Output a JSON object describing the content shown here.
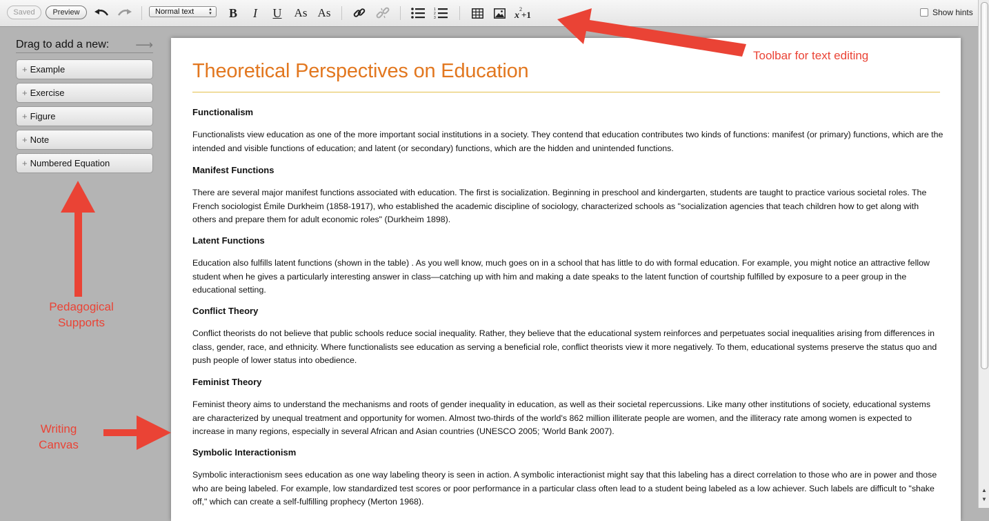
{
  "toolbar": {
    "saved_label": "Saved",
    "preview_label": "Preview",
    "style_select_value": "Normal text",
    "bold_glyph": "B",
    "italic_glyph": "I",
    "underline_glyph": "U",
    "superscript_glyph": "As",
    "subscript_glyph": "As",
    "show_hints_label": "Show hints",
    "show_hints_checked": false,
    "icons": [
      "undo-icon",
      "redo-icon",
      "link-icon",
      "unlink-icon",
      "bullet-list-icon",
      "numbered-list-icon",
      "table-icon",
      "image-icon",
      "math-icon"
    ]
  },
  "sidebar": {
    "heading": "Drag to add a new:",
    "items": [
      {
        "label": "Example"
      },
      {
        "label": "Exercise"
      },
      {
        "label": "Figure"
      },
      {
        "label": "Note"
      },
      {
        "label": "Numbered Equation"
      }
    ]
  },
  "document": {
    "title": "Theoretical Perspectives on Education",
    "sections": [
      {
        "heading": "Functionalism",
        "body": "Functionalists view education as one of the more important social institutions in a society. They contend that education contributes two kinds of functions: manifest (or primary) functions, which are the intended and visible functions of education; and latent (or secondary) functions, which are the hidden and unintended functions."
      },
      {
        "heading": "Manifest Functions",
        "body": "There are several major manifest functions associated with education. The first is socialization. Beginning in preschool and kindergarten, students are taught to practice various societal roles. The French sociologist Émile Durkheim (1858-1917), who established the academic discipline of sociology, characterized schools as \"socialization agencies that teach children how to get along with others and prepare them for adult economic roles\" (Durkheim 1898)."
      },
      {
        "heading": "Latent Functions",
        "body": "Education also fulfills latent functions (shown in the table) . As you well know, much goes on in a school that has little to do with formal education. For example, you might notice an attractive fellow student when he gives a particularly interesting answer in class—catching up with him and making a date speaks to the latent function of courtship fulfilled by exposure to a peer group in the educational setting."
      },
      {
        "heading": "Conflict Theory",
        "body": "Conflict theorists do not believe that public schools reduce social inequality. Rather, they believe that the educational system reinforces and perpetuates social inequalities arising from differences in class, gender, race, and ethnicity. Where functionalists see education as serving a beneficial role, conflict theorists view it more negatively. To them, educational systems preserve the status quo and push people of lower status into obedience."
      },
      {
        "heading": "Feminist Theory",
        "body": "Feminist theory aims to understand the mechanisms and roots of gender inequality in education, as well as their societal repercussions. Like many other institutions of society, educational systems are characterized by unequal treatment and opportunity for women. Almost two-thirds of the world's 862 million illiterate people are women, and the illiteracy rate among women is expected to increase in many regions, especially in several African and Asian countries (UNESCO 2005; 'World Bank 2007)."
      },
      {
        "heading": "Symbolic Interactionism",
        "body": "Symbolic interactionism sees education as one way labeling theory is seen in action. A symbolic interactionist might say that this labeling has a direct correlation to those who are in power and those who are being labeled. For example, low standardized test scores or poor performance in a particular class often lead to a student being labeled as a low achiever. Such labels are difficult to \"shake off,\" which can create a self-fulfilling prophecy (Merton 1968)."
      }
    ]
  },
  "annotations": {
    "toolbar_note": "Toolbar for text editing",
    "pedagogical_note_line1": "Pedagogical",
    "pedagogical_note_line2": "Supports",
    "canvas_note_line1": "Writing",
    "canvas_note_line2": "Canvas",
    "color": "#ea4335"
  },
  "colors": {
    "title": "#e2771f",
    "title_rule": "#e4c04a",
    "annotation": "#ea4335"
  }
}
